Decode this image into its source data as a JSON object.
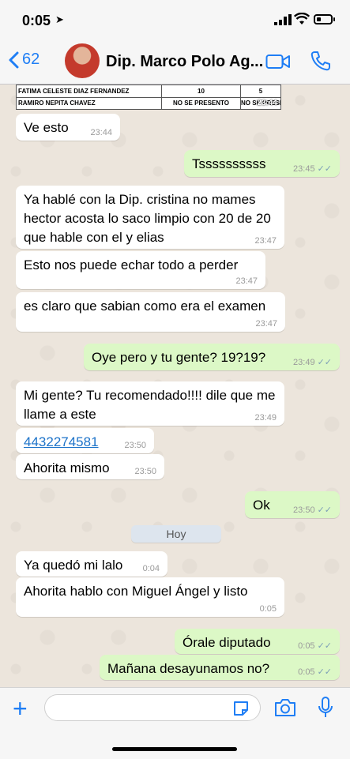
{
  "status": {
    "time": "0:05"
  },
  "header": {
    "back_count": "62",
    "title": "Dip. Marco Polo  Ag..."
  },
  "document": {
    "rows": [
      {
        "name": "FATIMA CELESTE DIAZ FERNANDEZ",
        "c2": "10",
        "c3": "5"
      },
      {
        "name": "RAMIRO NEPITA CHAVEZ",
        "c2": "NO SE PRESENTO",
        "c3": "NO SE PRESENTO"
      }
    ],
    "time": "23:44"
  },
  "messages": [
    {
      "text": "Ve esto",
      "time": "23:44"
    },
    {
      "text": "Tssssssssss",
      "time": "23:45"
    },
    {
      "text": "Ya hablé con la Dip. cristina no mames hector acosta lo saco limpio con 20 de 20 que hable con el y elias",
      "time": "23:47"
    },
    {
      "text": "Esto nos puede echar todo a perder",
      "time": "23:47"
    },
    {
      "text": "es claro que sabian como era el examen",
      "time": "23:47"
    },
    {
      "text": "Oye pero y tu gente? 19?19?",
      "time": "23:49"
    },
    {
      "text": "Mi gente? Tu recomendado!!!! dile que me llame a este",
      "time": "23:49"
    },
    {
      "text": "4432274581",
      "time": "23:50"
    },
    {
      "text": "Ahorita mismo",
      "time": "23:50"
    },
    {
      "text": "Ok",
      "time": "23:50"
    },
    {
      "text": "Ya quedó mi lalo",
      "time": "0:04"
    },
    {
      "text": "Ahorita hablo con Miguel Ángel y listo",
      "time": "0:05"
    },
    {
      "text": "Órale diputado",
      "time": "0:05"
    },
    {
      "text": "Mañana desayunamos no?",
      "time": "0:05"
    }
  ],
  "day_label": "Hoy",
  "icons": {
    "back": "chevron-left-icon",
    "video": "video-icon",
    "phone": "phone-icon",
    "plus": "plus-icon",
    "sticker": "sticker-icon",
    "camera": "camera-icon",
    "mic": "microphone-icon",
    "read": "double-check-icon"
  },
  "colors": {
    "accent": "#1f7ef5",
    "outgoing": "#dcf8c6",
    "incoming": "#ffffff",
    "background": "#ece5dc"
  }
}
